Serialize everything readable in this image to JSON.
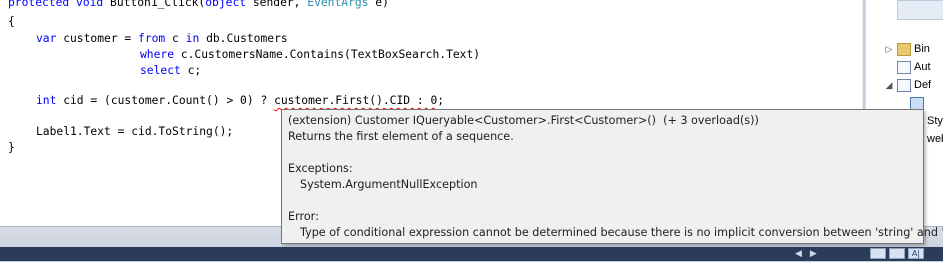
{
  "code": {
    "line1": {
      "kw": "protected void",
      "name": " Button1_Click(",
      "kw2": "object",
      "mid": " sender, ",
      "type": "EventArgs",
      "end": " e)"
    },
    "line2": "{",
    "line3": {
      "kw": "var",
      "mid": " customer = ",
      "kw2": "from",
      "mid2": " c ",
      "kw3": "in",
      "end": " db.Customers"
    },
    "line4": {
      "kw": "where",
      "end": " c.CustomersName.Contains(TextBoxSearch.Text)"
    },
    "line5": {
      "kw": "select",
      "end": " c;"
    },
    "line6": {
      "kw": "int",
      "pre": " cid = (customer.Count() > 0) ? ",
      "squiggle": "customer.First().CID : 0",
      "end": ";"
    },
    "line7": "Label1.Text = cid.ToString();",
    "line8": "}"
  },
  "tooltip": {
    "signature": "(extension) Customer IQueryable<Customer>.First<Customer>()  (+ 3 overload(s))",
    "summary": "Returns the first element of a sequence.",
    "exceptions_label": "Exceptions:",
    "exception": "System.ArgumentNullException",
    "error_label": "Error:",
    "error_message": "Type of conditional expression cannot be determined because there is no implicit conversion between 'string' and 'int'"
  },
  "solution_explorer": {
    "items": [
      {
        "label": "Bin"
      },
      {
        "label": "Aut"
      },
      {
        "label": "Def"
      },
      {
        "label": "Styl"
      },
      {
        "label": "web"
      }
    ]
  },
  "status": {
    "icon_label": "A|"
  }
}
